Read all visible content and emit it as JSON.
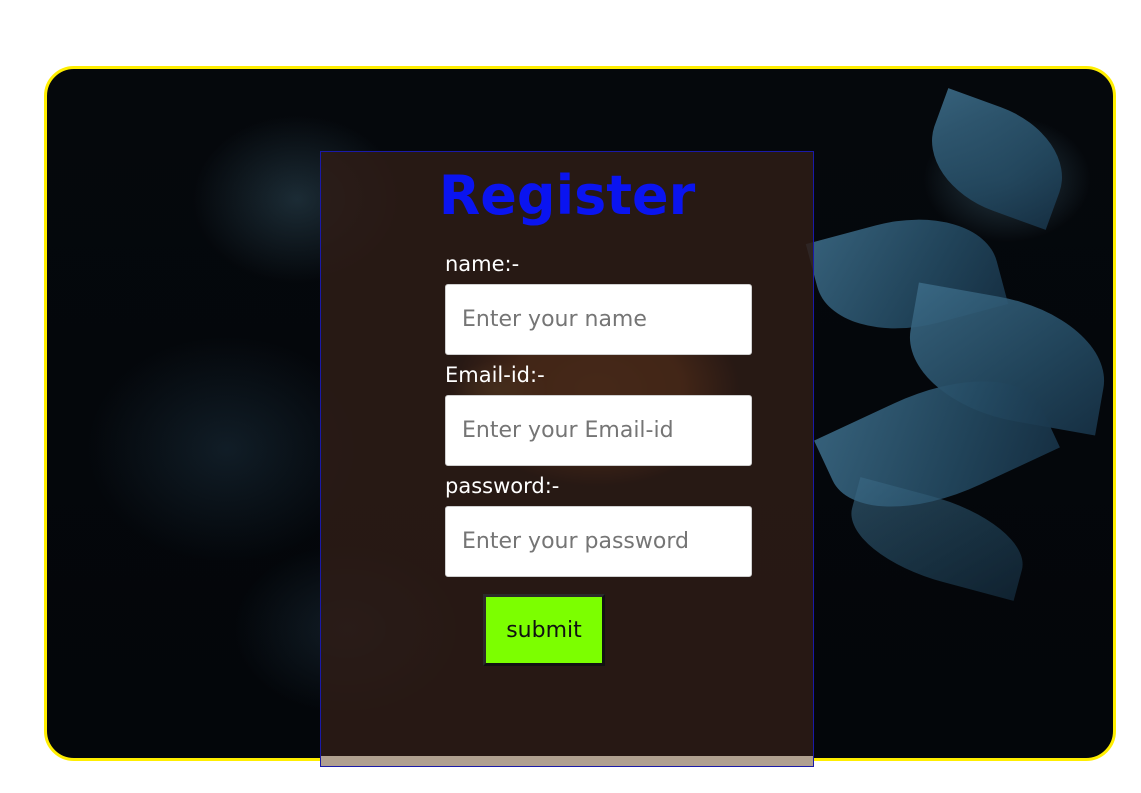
{
  "form": {
    "title": "Register",
    "name_label": "name:-",
    "name_placeholder": "Enter your name",
    "email_label": "Email-id:-",
    "email_placeholder": "Enter your Email-id",
    "password_label": "password:-",
    "password_placeholder": "Enter your password",
    "submit_label": "submit"
  },
  "colors": {
    "card_border": "#ffee00",
    "title": "#0a14f0",
    "submit_bg": "#7cff00",
    "panel_border": "#1a1aa8"
  }
}
